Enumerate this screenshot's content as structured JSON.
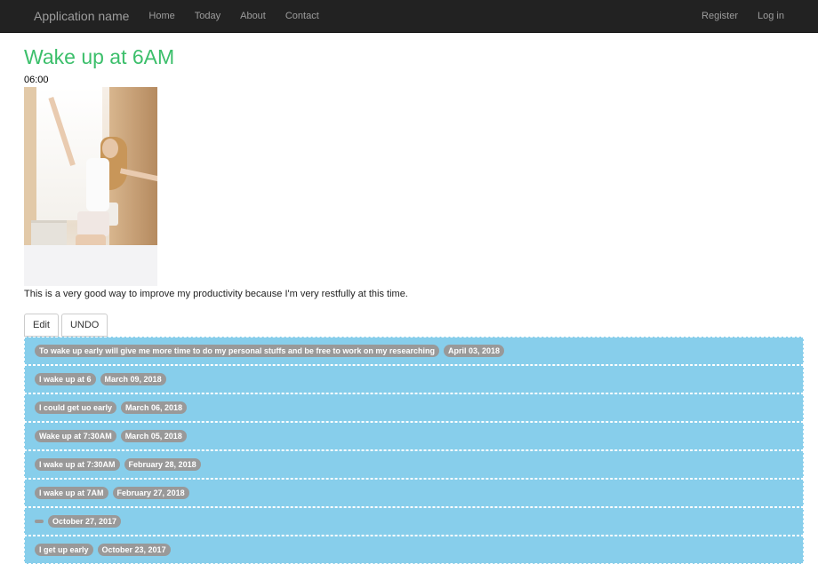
{
  "nav": {
    "brand": "Application name",
    "links": [
      "Home",
      "Today",
      "About",
      "Contact"
    ],
    "right": [
      "Register",
      "Log in"
    ]
  },
  "page": {
    "title": "Wake up at 6AM",
    "time": "06:00",
    "description": "This is a very good way to improve my productivity because I'm very restfully at this time."
  },
  "buttons": {
    "edit": "Edit",
    "undo": "UNDO"
  },
  "entries": [
    {
      "text": "To wake up early will give me more time to do my personal stuffs and be free to work on my researching",
      "date": "April 03, 2018"
    },
    {
      "text": "I wake up at 6",
      "date": "March 09, 2018"
    },
    {
      "text": "I could get uo early",
      "date": "March 06, 2018"
    },
    {
      "text": "Wake up at 7:30AM",
      "date": "March 05, 2018"
    },
    {
      "text": "I wake up at 7:30AM",
      "date": "February 28, 2018"
    },
    {
      "text": "I wake up at 7AM",
      "date": "February 27, 2018"
    },
    {
      "text": "",
      "date": "October 27, 2017"
    },
    {
      "text": "I get up early",
      "date": "October 23, 2017"
    }
  ],
  "colors": {
    "title": "#3cbf6b",
    "navbar": "#222222",
    "entry_bg": "#87ceeb",
    "badge": "#999999"
  }
}
